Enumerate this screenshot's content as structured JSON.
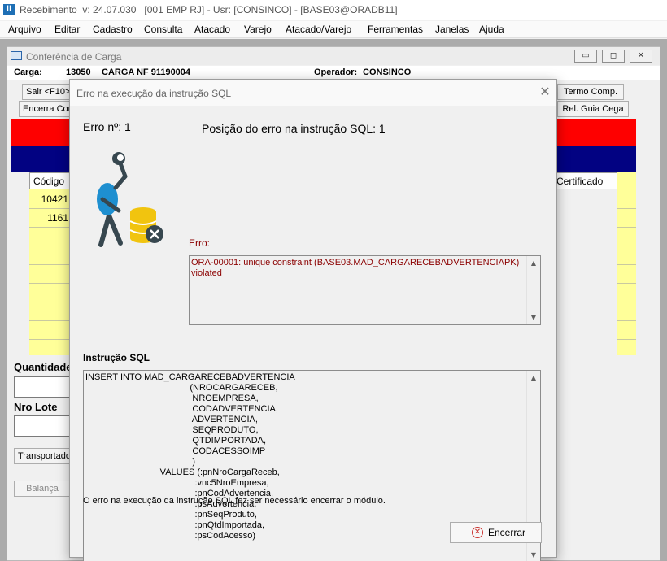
{
  "app": {
    "title": "Recebimento  v: 24.07.030   [001 EMP RJ] - Usr: [CONSINCO] - [BASE03@ORADB11]",
    "icon_glyph": "ll"
  },
  "menu": {
    "items": [
      "Arquivo",
      "Editar",
      "Cadastro",
      "Consulta",
      "Atacado",
      "Varejo",
      "Atacado/Varejo",
      "Ferramentas",
      "Janelas",
      "Ajuda"
    ]
  },
  "inner_window": {
    "title": "Conferência de Carga",
    "minimize_glyph": "▭",
    "restore_glyph": "◻",
    "close_glyph": "✕",
    "carga_label": "Carga:",
    "carga_number": "13050",
    "carga_desc": "CARGA NF 91190004",
    "operador_label": "Operador:",
    "operador_value": "CONSINCO",
    "buttons": {
      "sair": "Sair <F10>",
      "encerra_conf": "Encerra Conf",
      "termo_comp": "Termo Comp.",
      "rel_guia_cega": "Rel. Guia Cega",
      "transportador": "Transportador",
      "balanca": "Balança"
    },
    "grid": {
      "header_codigo": "Código",
      "header_certificado": "Certificado",
      "rows": [
        "10421",
        "1161"
      ]
    },
    "quantidade_label": "Quantidade",
    "nro_lote_label": "Nro Lote"
  },
  "dialog": {
    "title": "Erro na execução da instrução SQL",
    "close_glyph": "✕",
    "erro_num_label": "Erro nº: 1",
    "posicao_label": "Posição do erro na instrução SQL: 1",
    "erro_label": "Erro:",
    "erro_text": "ORA-00001: unique constraint (BASE03.MAD_CARGARECEBADVERTENCIAPK)\nviolated",
    "instrucao_label": "Instrução SQL",
    "sql_text": "INSERT INTO MAD_CARGARECEBADVERTENCIA\n                                          (NROCARGARECEB,\n                                           NROEMPRESA,\n                                           CODADVERTENCIA,\n                                           ADVERTENCIA,\n                                           SEQPRODUTO,\n                                           QTDIMPORTADA,\n                                           CODACESSOIMP\n                                           )\n                              VALUES (:pnNroCargaReceb,\n                                            :vnc5NroEmpresa,\n                                            :pnCodAdvertencia,\n                                            :psAdvertencia,\n                                            :pnSeqProduto,\n                                            :pnQtdImportada,\n                                            :psCodAcesso)",
    "message": "O erro na execução da instrução SQL fez ser necessário encerrar o módulo.",
    "encerrar_label": "Encerrar",
    "encerrar_glyph": "✕",
    "scroll_up_glyph": "▲",
    "scroll_down_glyph": "▼"
  }
}
